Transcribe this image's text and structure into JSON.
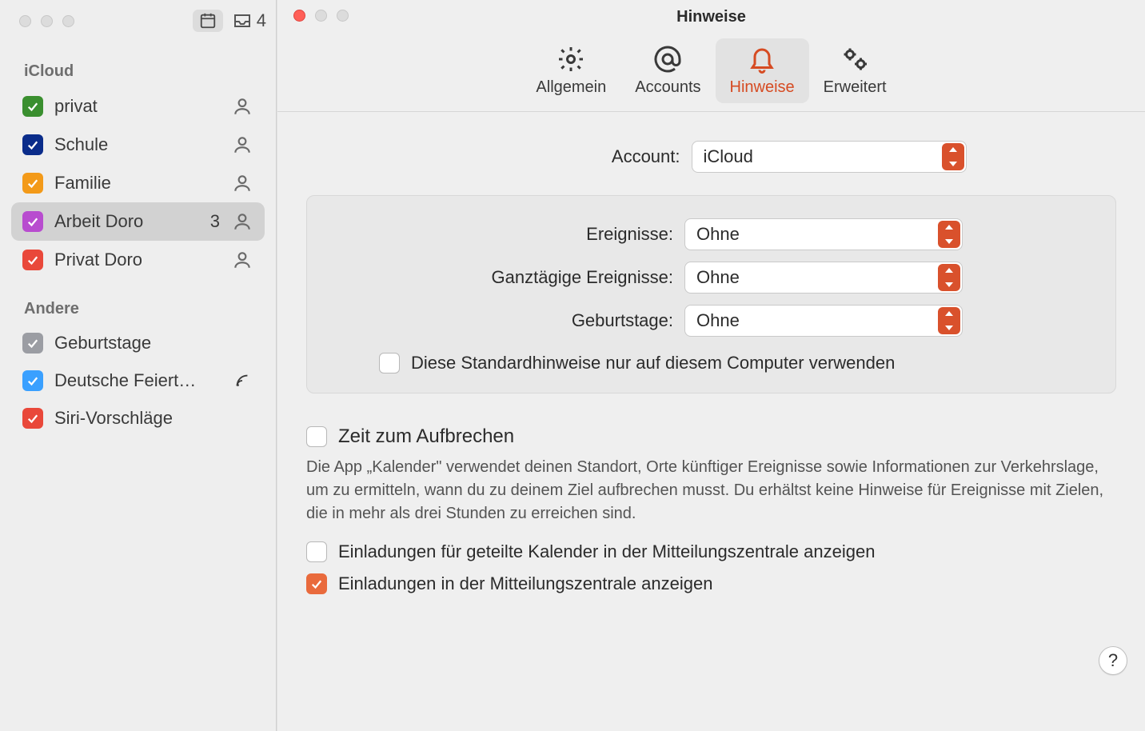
{
  "sidebar": {
    "inbox_count": "4",
    "sections": [
      {
        "label": "iCloud",
        "items": [
          {
            "name": "privat",
            "color": "#3a8f2f",
            "checked": true,
            "shared": true,
            "selected": false
          },
          {
            "name": "Schule",
            "color": "#0a2c8a",
            "checked": true,
            "shared": true,
            "selected": false
          },
          {
            "name": "Familie",
            "color": "#f39a19",
            "checked": true,
            "shared": true,
            "selected": false
          },
          {
            "name": "Arbeit Doro",
            "color": "#b84ccf",
            "checked": true,
            "shared": true,
            "selected": true,
            "count": "3"
          },
          {
            "name": "Privat Doro",
            "color": "#e9483a",
            "checked": true,
            "shared": true,
            "selected": false
          }
        ]
      },
      {
        "label": "Andere",
        "items": [
          {
            "name": "Geburtstage",
            "color": "#9b9da3",
            "checked": true,
            "selected": false
          },
          {
            "name": "Deutsche Feiert…",
            "color": "#3aa0ff",
            "checked": true,
            "selected": false,
            "broadcast": true
          },
          {
            "name": "Siri-Vorschläge",
            "color": "#e9483a",
            "checked": true,
            "selected": false
          }
        ]
      }
    ]
  },
  "prefs": {
    "title": "Hinweise",
    "tabs": {
      "general": "Allgemein",
      "accounts": "Accounts",
      "alerts": "Hinweise",
      "advanced": "Erweitert"
    },
    "account_label": "Account:",
    "account_value": "iCloud",
    "group": {
      "events_label": "Ereignisse:",
      "events_value": "Ohne",
      "allday_label": "Ganztägige Ereignisse:",
      "allday_value": "Ohne",
      "birthday_label": "Geburtstage:",
      "birthday_value": "Ohne",
      "only_this_computer": "Diese Standardhinweise nur auf diesem Computer verwenden",
      "only_this_computer_checked": false
    },
    "time_to_leave_label": "Zeit zum Aufbrechen",
    "time_to_leave_checked": false,
    "time_to_leave_desc": "Die App „Kalender\" verwendet deinen Standort, Orte künftiger Ereignisse sowie Informationen zur Verkehrslage, um zu ermitteln, wann du zu deinem Ziel aufbrechen musst. Du erhältst keine Hinweise für Ereignisse mit Zielen, die in mehr als drei Stunden zu erreichen sind.",
    "shared_invites_label": "Einladungen für geteilte Kalender in der Mitteilungszentrale anzeigen",
    "shared_invites_checked": false,
    "invites_label": "Einladungen in der Mitteilungszentrale anzeigen",
    "invites_checked": true,
    "help": "?"
  }
}
